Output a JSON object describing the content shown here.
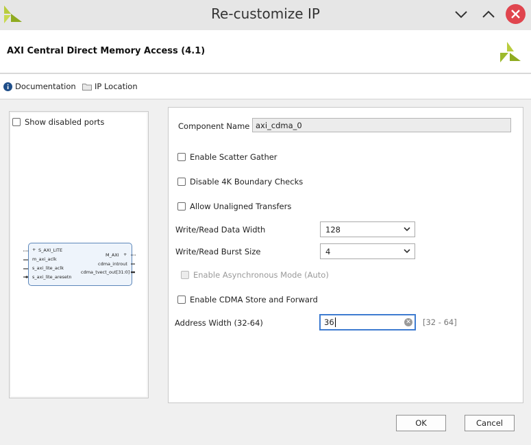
{
  "window": {
    "title": "Re-customize IP"
  },
  "header": {
    "title": "AXI Central Direct Memory Access (4.1)"
  },
  "toolbar": {
    "documentation": "Documentation",
    "ip_location": "IP Location"
  },
  "left_panel": {
    "show_disabled_ports": {
      "label": "Show disabled ports",
      "checked": false
    },
    "symbol": {
      "left_ports": [
        "S_AXI_LITE",
        "m_axi_aclk",
        "s_axi_lite_aclk",
        "s_axi_lite_aresetn"
      ],
      "right_ports": [
        "M_AXI",
        "cdma_introut",
        "cdma_tvect_out[31:0]"
      ]
    }
  },
  "form": {
    "component_name": {
      "label": "Component Name",
      "value": "axi_cdma_0"
    },
    "enable_scatter_gather": {
      "label": "Enable Scatter Gather",
      "checked": false
    },
    "disable_4k": {
      "label": "Disable 4K Boundary Checks",
      "checked": false
    },
    "allow_unaligned": {
      "label": "Allow Unaligned Transfers",
      "checked": false
    },
    "data_width": {
      "label": "Write/Read Data Width",
      "value": "128"
    },
    "burst_size": {
      "label": "Write/Read Burst Size",
      "value": "4"
    },
    "async_mode": {
      "label": "Enable Asynchronous Mode (Auto)",
      "checked": false,
      "disabled": true
    },
    "store_forward": {
      "label": "Enable CDMA Store and Forward",
      "checked": false
    },
    "address_width": {
      "label": "Address Width (32-64)",
      "value": "36",
      "range_hint": "[32 - 64]"
    }
  },
  "buttons": {
    "ok": "OK",
    "cancel": "Cancel"
  },
  "colors": {
    "accent": "#3d7bd0",
    "close": "#e0454e",
    "logo": "#9dba2c"
  }
}
